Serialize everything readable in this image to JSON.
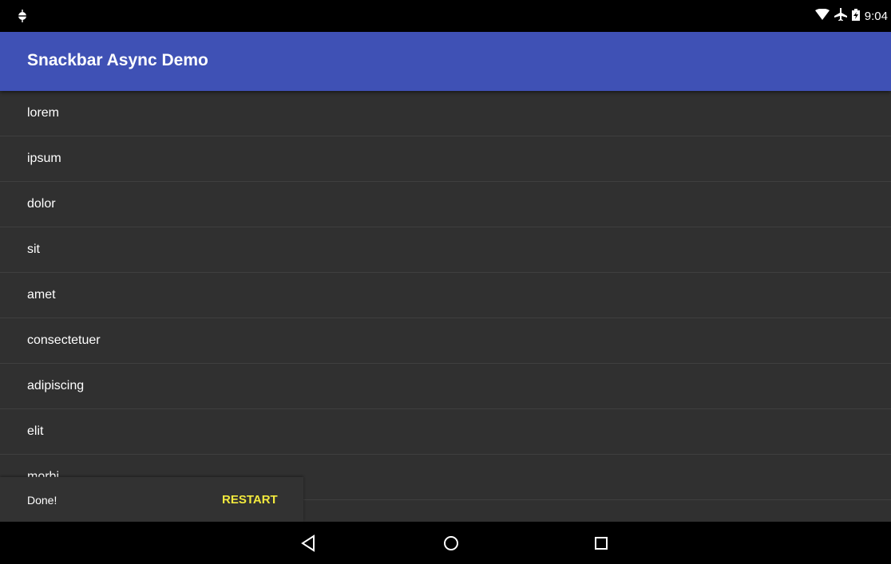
{
  "status_bar": {
    "time": "9:04",
    "left_icon": "android-debug-icon",
    "right_icons": [
      "wifi-icon",
      "airplane-mode-icon",
      "battery-charging-icon"
    ]
  },
  "app_bar": {
    "title": "Snackbar Async Demo",
    "color": "#3f51b5"
  },
  "list": {
    "items": [
      "lorem",
      "ipsum",
      "dolor",
      "sit",
      "amet",
      "consectetuer",
      "adipiscing",
      "elit",
      "morbi"
    ]
  },
  "snackbar": {
    "message": "Done!",
    "action_label": "RESTART",
    "action_color": "#f2e93d"
  },
  "nav_bar": {
    "buttons": [
      "back-icon",
      "home-icon",
      "recents-icon"
    ]
  }
}
